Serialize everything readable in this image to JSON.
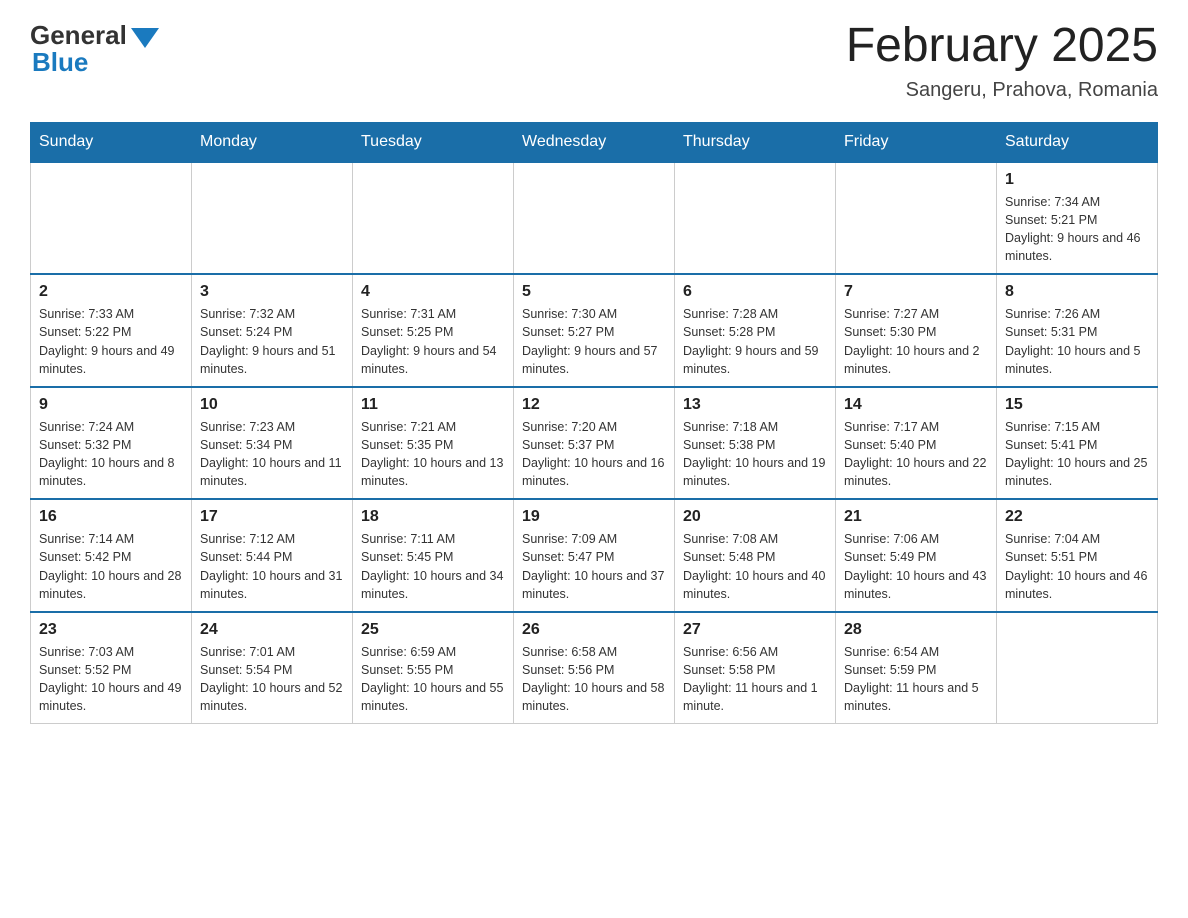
{
  "header": {
    "logo_general": "General",
    "logo_blue": "Blue",
    "month_title": "February 2025",
    "location": "Sangeru, Prahova, Romania"
  },
  "weekdays": [
    "Sunday",
    "Monday",
    "Tuesday",
    "Wednesday",
    "Thursday",
    "Friday",
    "Saturday"
  ],
  "weeks": [
    [
      {
        "day": "",
        "info": ""
      },
      {
        "day": "",
        "info": ""
      },
      {
        "day": "",
        "info": ""
      },
      {
        "day": "",
        "info": ""
      },
      {
        "day": "",
        "info": ""
      },
      {
        "day": "",
        "info": ""
      },
      {
        "day": "1",
        "info": "Sunrise: 7:34 AM\nSunset: 5:21 PM\nDaylight: 9 hours and 46 minutes."
      }
    ],
    [
      {
        "day": "2",
        "info": "Sunrise: 7:33 AM\nSunset: 5:22 PM\nDaylight: 9 hours and 49 minutes."
      },
      {
        "day": "3",
        "info": "Sunrise: 7:32 AM\nSunset: 5:24 PM\nDaylight: 9 hours and 51 minutes."
      },
      {
        "day": "4",
        "info": "Sunrise: 7:31 AM\nSunset: 5:25 PM\nDaylight: 9 hours and 54 minutes."
      },
      {
        "day": "5",
        "info": "Sunrise: 7:30 AM\nSunset: 5:27 PM\nDaylight: 9 hours and 57 minutes."
      },
      {
        "day": "6",
        "info": "Sunrise: 7:28 AM\nSunset: 5:28 PM\nDaylight: 9 hours and 59 minutes."
      },
      {
        "day": "7",
        "info": "Sunrise: 7:27 AM\nSunset: 5:30 PM\nDaylight: 10 hours and 2 minutes."
      },
      {
        "day": "8",
        "info": "Sunrise: 7:26 AM\nSunset: 5:31 PM\nDaylight: 10 hours and 5 minutes."
      }
    ],
    [
      {
        "day": "9",
        "info": "Sunrise: 7:24 AM\nSunset: 5:32 PM\nDaylight: 10 hours and 8 minutes."
      },
      {
        "day": "10",
        "info": "Sunrise: 7:23 AM\nSunset: 5:34 PM\nDaylight: 10 hours and 11 minutes."
      },
      {
        "day": "11",
        "info": "Sunrise: 7:21 AM\nSunset: 5:35 PM\nDaylight: 10 hours and 13 minutes."
      },
      {
        "day": "12",
        "info": "Sunrise: 7:20 AM\nSunset: 5:37 PM\nDaylight: 10 hours and 16 minutes."
      },
      {
        "day": "13",
        "info": "Sunrise: 7:18 AM\nSunset: 5:38 PM\nDaylight: 10 hours and 19 minutes."
      },
      {
        "day": "14",
        "info": "Sunrise: 7:17 AM\nSunset: 5:40 PM\nDaylight: 10 hours and 22 minutes."
      },
      {
        "day": "15",
        "info": "Sunrise: 7:15 AM\nSunset: 5:41 PM\nDaylight: 10 hours and 25 minutes."
      }
    ],
    [
      {
        "day": "16",
        "info": "Sunrise: 7:14 AM\nSunset: 5:42 PM\nDaylight: 10 hours and 28 minutes."
      },
      {
        "day": "17",
        "info": "Sunrise: 7:12 AM\nSunset: 5:44 PM\nDaylight: 10 hours and 31 minutes."
      },
      {
        "day": "18",
        "info": "Sunrise: 7:11 AM\nSunset: 5:45 PM\nDaylight: 10 hours and 34 minutes."
      },
      {
        "day": "19",
        "info": "Sunrise: 7:09 AM\nSunset: 5:47 PM\nDaylight: 10 hours and 37 minutes."
      },
      {
        "day": "20",
        "info": "Sunrise: 7:08 AM\nSunset: 5:48 PM\nDaylight: 10 hours and 40 minutes."
      },
      {
        "day": "21",
        "info": "Sunrise: 7:06 AM\nSunset: 5:49 PM\nDaylight: 10 hours and 43 minutes."
      },
      {
        "day": "22",
        "info": "Sunrise: 7:04 AM\nSunset: 5:51 PM\nDaylight: 10 hours and 46 minutes."
      }
    ],
    [
      {
        "day": "23",
        "info": "Sunrise: 7:03 AM\nSunset: 5:52 PM\nDaylight: 10 hours and 49 minutes."
      },
      {
        "day": "24",
        "info": "Sunrise: 7:01 AM\nSunset: 5:54 PM\nDaylight: 10 hours and 52 minutes."
      },
      {
        "day": "25",
        "info": "Sunrise: 6:59 AM\nSunset: 5:55 PM\nDaylight: 10 hours and 55 minutes."
      },
      {
        "day": "26",
        "info": "Sunrise: 6:58 AM\nSunset: 5:56 PM\nDaylight: 10 hours and 58 minutes."
      },
      {
        "day": "27",
        "info": "Sunrise: 6:56 AM\nSunset: 5:58 PM\nDaylight: 11 hours and 1 minute."
      },
      {
        "day": "28",
        "info": "Sunrise: 6:54 AM\nSunset: 5:59 PM\nDaylight: 11 hours and 5 minutes."
      },
      {
        "day": "",
        "info": ""
      }
    ]
  ]
}
